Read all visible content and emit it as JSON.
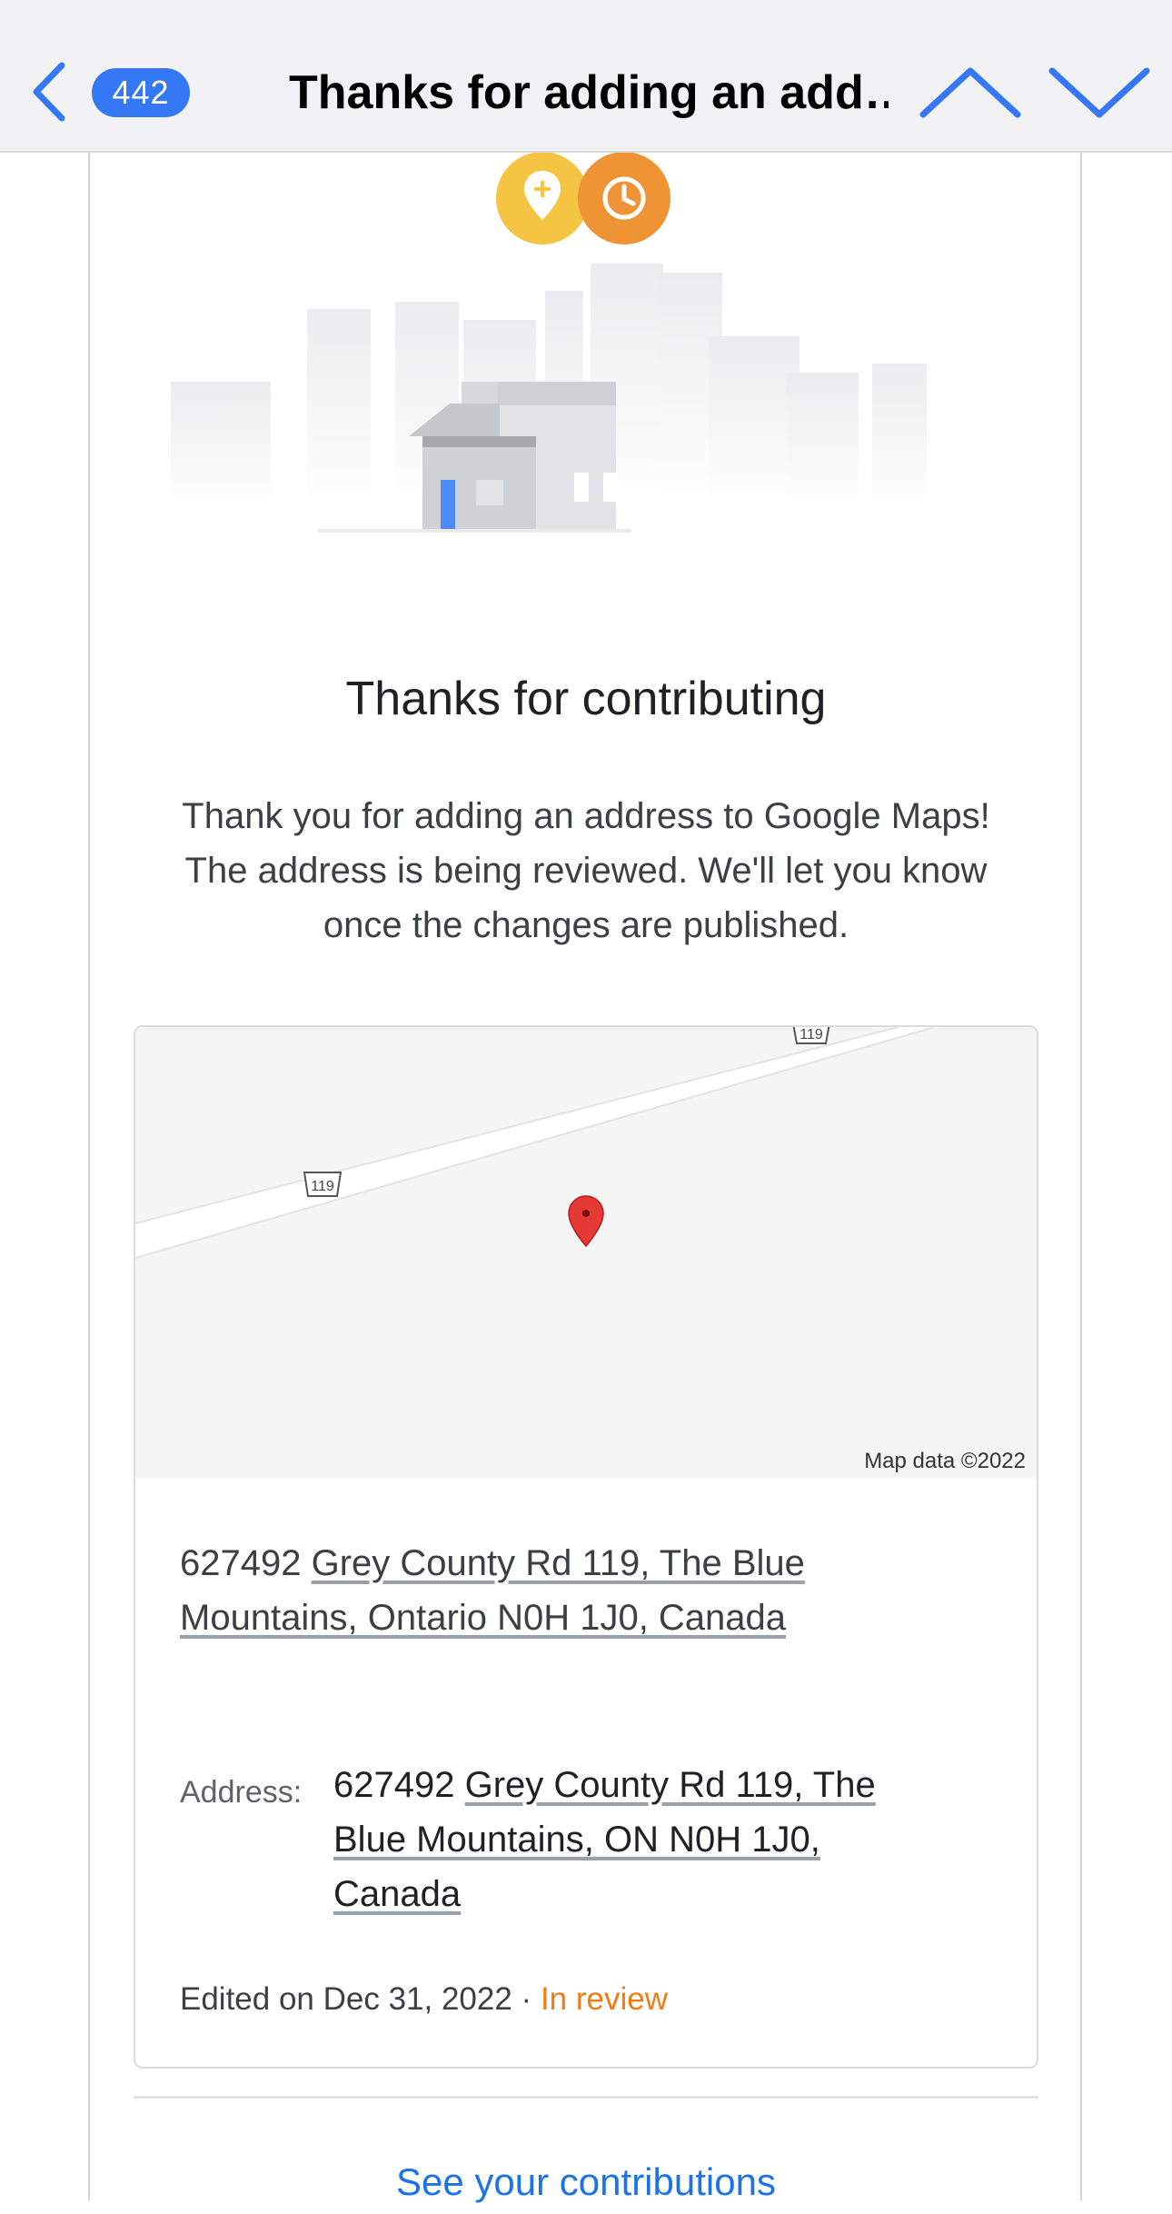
{
  "nav": {
    "unread_count": "442",
    "title": "Thanks for adding an add…"
  },
  "email": {
    "heading": "Thanks for contributing",
    "body": "Thank you for adding an address to Google Maps! The address is being reviewed. We'll let you know once the changes are published.",
    "map": {
      "road_shield_label": "119",
      "attribution": "Map data ©2022"
    },
    "card_address": {
      "number": "627492",
      "street": "Grey County Rd 119, The Blue Mountains, Ontario N0H 1J0, Canada"
    },
    "address_label": "Address:",
    "address_value": {
      "number": "627492",
      "street": "Grey County Rd 119, The Blue Mountains, ON N0H 1J0, Canada"
    },
    "edited": "Edited on Dec 31, 2022 · ",
    "status": "In review",
    "see_contributions": "See your contributions"
  },
  "colors": {
    "accent_blue": "#3478f6",
    "link_blue": "#1a73e8",
    "status_orange": "#f07d11",
    "pin_red": "#e53935",
    "badge_yellow": "#f6c443",
    "badge_orange": "#ef9434"
  },
  "icons": {
    "back": "chevron-left-icon",
    "prev": "chevron-up-icon",
    "next": "chevron-down-icon",
    "add_place": "add-place-icon",
    "pending": "clock-icon",
    "map_pin": "map-pin-icon"
  }
}
